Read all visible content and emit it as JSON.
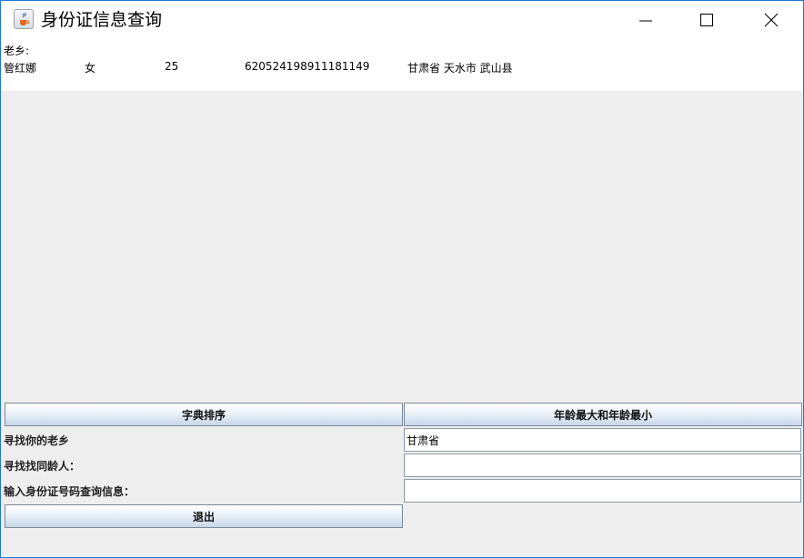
{
  "window": {
    "title": "身份证信息查询",
    "app_icon": "java-coffee-icon"
  },
  "output": {
    "label": "老乡:",
    "rows": [
      {
        "name": "管红娜",
        "sex": "女",
        "age": "25",
        "id": "620524198911181149",
        "address": "甘肃省 天水市 武山县"
      }
    ]
  },
  "buttons": {
    "sort": "字典排序",
    "age_range": "年龄最大和年龄最小",
    "exit": "退出"
  },
  "labels": {
    "hometown": "寻找你的老乡",
    "same_age": "寻找找同龄人：",
    "id_query": "输入身份证号码查询信息："
  },
  "inputs": {
    "hometown_value": "甘肃省",
    "same_age_value": "",
    "id_value": ""
  },
  "colors": {
    "border_accent": "#1c78d4",
    "button_gradient_end": "#c7d8ea"
  }
}
